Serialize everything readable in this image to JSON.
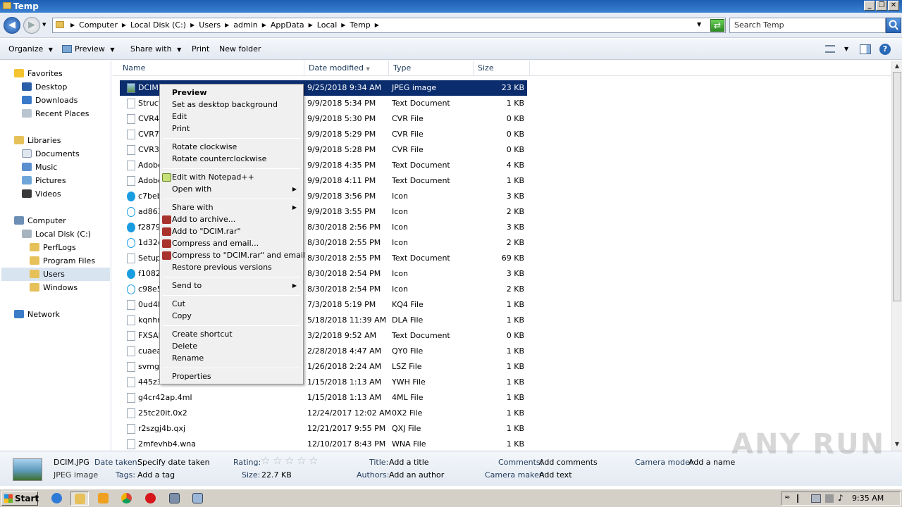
{
  "window": {
    "title": "Temp"
  },
  "address": {
    "crumbs": [
      "Computer",
      "Local Disk (C:)",
      "Users",
      "admin",
      "AppData",
      "Local",
      "Temp"
    ]
  },
  "search": {
    "placeholder": "Search Temp"
  },
  "toolbar": {
    "organize": "Organize",
    "preview": "Preview",
    "share_with": "Share with",
    "print": "Print",
    "new_folder": "New folder"
  },
  "nav": {
    "favorites": "Favorites",
    "desktop": "Desktop",
    "downloads": "Downloads",
    "recent": "Recent Places",
    "libraries": "Libraries",
    "documents": "Documents",
    "music": "Music",
    "pictures": "Pictures",
    "videos": "Videos",
    "computer": "Computer",
    "localdisk": "Local Disk (C:)",
    "perflogs": "PerfLogs",
    "programfiles": "Program Files",
    "users": "Users",
    "windows": "Windows",
    "network": "Network"
  },
  "columns": {
    "name": "Name",
    "date": "Date modified",
    "type": "Type",
    "size": "Size"
  },
  "files": [
    {
      "name": "DCIM.JPG",
      "date": "9/25/2018 9:34 AM",
      "type": "JPEG image",
      "size": "23 KB",
      "icon": "image-icon"
    },
    {
      "name": "Struct",
      "date": "9/9/2018 5:34 PM",
      "type": "Text Document",
      "size": "1 KB",
      "icon": "file-icon"
    },
    {
      "name": "CVR49",
      "date": "9/9/2018 5:30 PM",
      "type": "CVR File",
      "size": "0 KB",
      "icon": "file-icon"
    },
    {
      "name": "CVR7E",
      "date": "9/9/2018 5:29 PM",
      "type": "CVR File",
      "size": "0 KB",
      "icon": "file-icon"
    },
    {
      "name": "CVR35",
      "date": "9/9/2018 5:28 PM",
      "type": "CVR File",
      "size": "0 KB",
      "icon": "file-icon"
    },
    {
      "name": "Adobe",
      "date": "9/9/2018 4:35 PM",
      "type": "Text Document",
      "size": "4 KB",
      "icon": "file-icon"
    },
    {
      "name": "Adobe",
      "date": "9/9/2018 4:11 PM",
      "type": "Text Document",
      "size": "1 KB",
      "icon": "file-icon"
    },
    {
      "name": "c7beb",
      "date": "9/9/2018 3:56 PM",
      "type": "Icon",
      "size": "3 KB",
      "icon": "skype-icon"
    },
    {
      "name": "ad863",
      "date": "9/9/2018 3:55 PM",
      "type": "Icon",
      "size": "2 KB",
      "icon": "skype-outline-icon"
    },
    {
      "name": "f2879",
      "date": "8/30/2018 2:56 PM",
      "type": "Icon",
      "size": "3 KB",
      "icon": "skype-icon"
    },
    {
      "name": "1d32c",
      "date": "8/30/2018 2:55 PM",
      "type": "Icon",
      "size": "2 KB",
      "icon": "skype-outline-icon"
    },
    {
      "name": "Setup",
      "date": "8/30/2018 2:55 PM",
      "type": "Text Document",
      "size": "69 KB",
      "icon": "file-icon"
    },
    {
      "name": "f1082",
      "date": "8/30/2018 2:54 PM",
      "type": "Icon",
      "size": "3 KB",
      "icon": "skype-icon"
    },
    {
      "name": "c98e5",
      "date": "8/30/2018 2:54 PM",
      "type": "Icon",
      "size": "2 KB",
      "icon": "skype-outline-icon"
    },
    {
      "name": "0ud4k",
      "date": "7/3/2018 5:19 PM",
      "type": "KQ4 File",
      "size": "1 KB",
      "icon": "file-icon"
    },
    {
      "name": "kqnhr",
      "date": "5/18/2018 11:39 AM",
      "type": "DLA File",
      "size": "1 KB",
      "icon": "file-icon"
    },
    {
      "name": "FXSAP",
      "date": "3/2/2018 9:52 AM",
      "type": "Text Document",
      "size": "0 KB",
      "icon": "file-icon"
    },
    {
      "name": "cuaea",
      "date": "2/28/2018 4:47 AM",
      "type": "QY0 File",
      "size": "1 KB",
      "icon": "file-icon"
    },
    {
      "name": "svmg",
      "date": "1/26/2018 2:24 AM",
      "type": "LSZ File",
      "size": "1 KB",
      "icon": "file-icon"
    },
    {
      "name": "445z3",
      "date": "1/15/2018 1:13 AM",
      "type": "YWH File",
      "size": "1 KB",
      "icon": "file-icon"
    },
    {
      "name": "g4cr42ap.4ml",
      "date": "1/15/2018 1:13 AM",
      "type": "4ML File",
      "size": "1 KB",
      "icon": "file-icon"
    },
    {
      "name": "25tc20it.0x2",
      "date": "12/24/2017 12:02 AM",
      "type": "0X2 File",
      "size": "1 KB",
      "icon": "file-icon"
    },
    {
      "name": "r2szgj4b.qxj",
      "date": "12/21/2017 9:55 PM",
      "type": "QXJ File",
      "size": "1 KB",
      "icon": "file-icon"
    },
    {
      "name": "2mfevhb4.wna",
      "date": "12/10/2017 8:43 PM",
      "type": "WNA File",
      "size": "1 KB",
      "icon": "file-icon"
    }
  ],
  "context_menu": {
    "preview": "Preview",
    "set_bg": "Set as desktop background",
    "edit": "Edit",
    "print": "Print",
    "rot_cw": "Rotate clockwise",
    "rot_ccw": "Rotate counterclockwise",
    "notepad": "Edit with Notepad++",
    "open_with": "Open with",
    "share_with": "Share with",
    "add_archive": "Add to archive...",
    "add_rar": "Add to \"DCIM.rar\"",
    "compress_email": "Compress and email...",
    "compress_rar_email": "Compress to \"DCIM.rar\" and email",
    "restore": "Restore previous versions",
    "send_to": "Send to",
    "cut": "Cut",
    "copy": "Copy",
    "shortcut": "Create shortcut",
    "delete": "Delete",
    "rename": "Rename",
    "properties": "Properties"
  },
  "details": {
    "filename": "DCIM.JPG",
    "filetype": "JPEG image",
    "date_taken_label": "Date taken:",
    "date_taken": "Specify date taken",
    "tags_label": "Tags:",
    "tags": "Add a tag",
    "rating_label": "Rating:",
    "rating": 0,
    "size_label": "Size:",
    "size": "22.7 KB",
    "title_label": "Title:",
    "title": "Add a title",
    "authors_label": "Authors:",
    "authors": "Add an author",
    "comments_label": "Comments:",
    "comments": "Add comments",
    "camera_maker_label": "Camera maker:",
    "camera_maker": "Add text",
    "camera_model_label": "Camera model:",
    "camera_model": "Add a name"
  },
  "taskbar": {
    "start": "Start",
    "clock": "9:35 AM"
  },
  "watermark": "ANY RUN",
  "colors": {
    "selection": "#0b2d6e",
    "title_bar": "#1e5fb3"
  }
}
